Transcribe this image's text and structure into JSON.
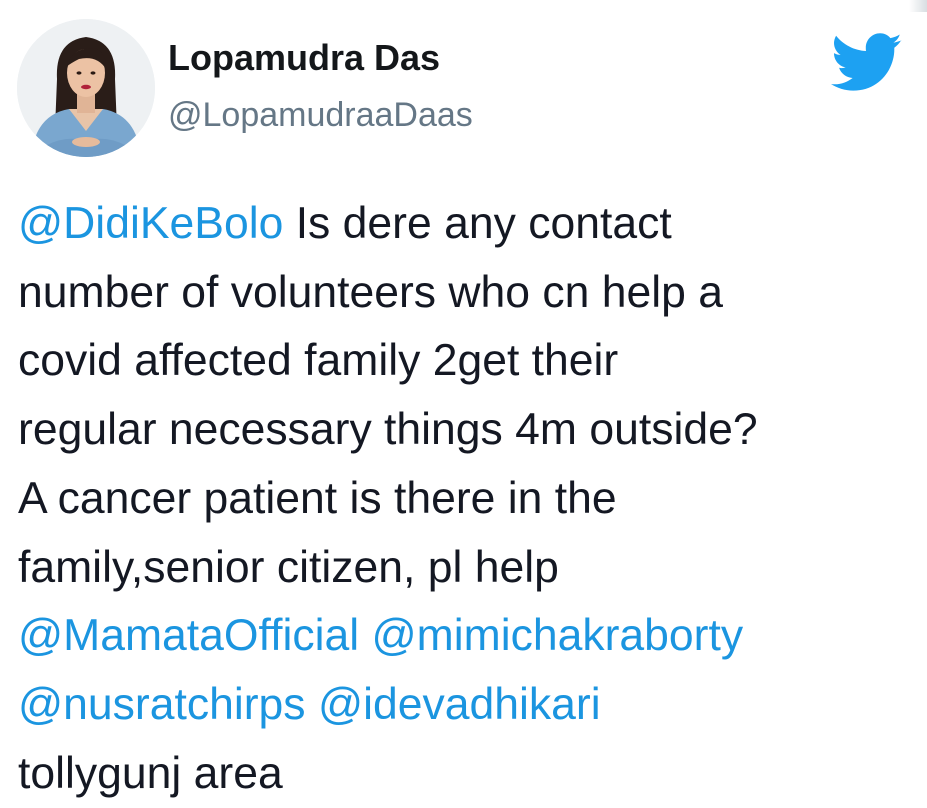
{
  "author": {
    "display_name": "Lopamudra Das",
    "handle": "@LopamudraaDaas"
  },
  "brand": {
    "logo_icon": "twitter-bird-icon",
    "logo_color": "#1da1f2"
  },
  "tweet": {
    "link_color": "#1b95e0",
    "text_color": "#141823",
    "lines": [
      {
        "mention": "@DidiKeBolo",
        "text": " Is dere any contact"
      },
      {
        "text": "number of volunteers who cn help a"
      },
      {
        "text": "covid affected family 2get their"
      },
      {
        "text": "regular necessary things 4m outside?"
      },
      {
        "text": "A cancer patient is there in the"
      },
      {
        "text": "family,senior citizen, pl help"
      },
      {
        "mention": "@MamataOfficial",
        "text": " ",
        "mention2": "@mimichakraborty"
      },
      {
        "mention": "@nusratchirps",
        "text": " ",
        "mention2": "@idevadhikari"
      },
      {
        "text": "tollygunj area"
      }
    ]
  }
}
